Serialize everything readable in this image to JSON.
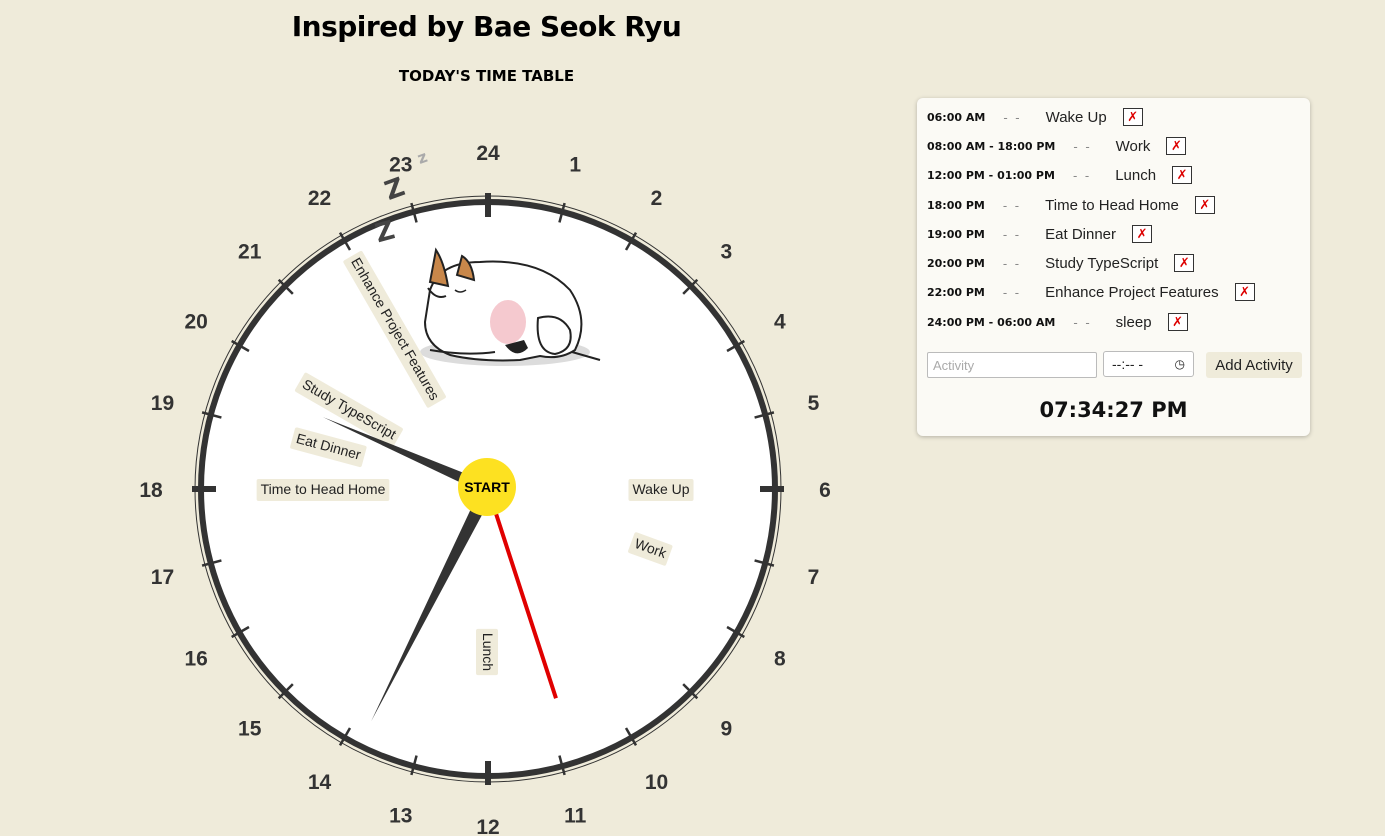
{
  "header": {
    "title": "Inspired by Bae Seok Ryu",
    "subtitle": "TODAY'S TIME TABLE"
  },
  "clock": {
    "hour_numbers": [
      "24",
      "1",
      "2",
      "3",
      "4",
      "5",
      "6",
      "7",
      "8",
      "9",
      "10",
      "11",
      "12",
      "13",
      "14",
      "15",
      "16",
      "17",
      "18",
      "19",
      "20",
      "21",
      "22",
      "23"
    ],
    "center_label": "START",
    "zzz": [
      "z",
      "Z",
      "Z"
    ],
    "activity_labels": [
      {
        "label": "Wake Up",
        "hour": 6
      },
      {
        "label": "Work",
        "hour": 7.33
      },
      {
        "label": "Lunch",
        "hour": 12
      },
      {
        "label": "Time to Head Home",
        "hour": 18
      },
      {
        "label": "Eat Dinner",
        "hour": 19
      },
      {
        "label": "Study TypeScript",
        "hour": 20
      },
      {
        "label": "Enhance Project Features",
        "hour": 22
      }
    ],
    "hands": {
      "hour_hand_hours": 19.57,
      "minute_hand_minutes": 34.45,
      "second_hand_seconds": 27
    }
  },
  "schedule": {
    "items": [
      {
        "time": "06:00 AM",
        "name": "Wake Up"
      },
      {
        "time": "08:00 AM - 18:00 PM",
        "name": "Work"
      },
      {
        "time": "12:00 PM - 01:00 PM",
        "name": "Lunch"
      },
      {
        "time": "18:00 PM",
        "name": "Time to Head Home"
      },
      {
        "time": "19:00 PM",
        "name": "Eat Dinner"
      },
      {
        "time": "20:00 PM",
        "name": "Study TypeScript"
      },
      {
        "time": "22:00 PM",
        "name": "Enhance Project Features"
      },
      {
        "time": "24:00 PM - 06:00 AM",
        "name": "sleep"
      }
    ],
    "separator": "- -",
    "delete_symbol": "✗",
    "activity_placeholder": "Activity",
    "time_value": "--:-- -",
    "clock_icon": "clock-icon",
    "add_label": "Add Activity",
    "digital_time": "07:34:27 PM"
  },
  "colors": {
    "background": "#efebda",
    "center_dot": "#fde121",
    "second_hand": "#e00000",
    "hands": "#333333",
    "delete_x": "#dd0000"
  }
}
